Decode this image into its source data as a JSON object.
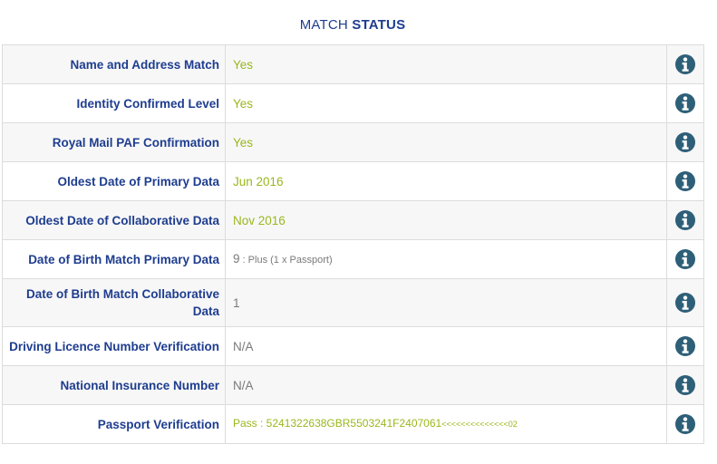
{
  "header": {
    "title_prefix": "MATCH",
    "title_strong": "STATUS"
  },
  "colors": {
    "label": "#1e3d8f",
    "value_positive": "#9ab71d",
    "value_neutral": "#7a7a7a",
    "info_icon": "#2e5f78"
  },
  "rows": [
    {
      "label": "Name and Address Match",
      "value": "Yes",
      "tone": "green",
      "icon": "info-icon"
    },
    {
      "label": "Identity Confirmed Level",
      "value": "Yes",
      "tone": "green",
      "icon": "info-icon"
    },
    {
      "label": "Royal Mail PAF Confirmation",
      "value": "Yes",
      "tone": "green",
      "icon": "info-icon"
    },
    {
      "label": "Oldest Date of Primary Data",
      "value": "Jun 2016",
      "tone": "green",
      "icon": "info-icon"
    },
    {
      "label": "Oldest Date of Collaborative Data",
      "value": "Nov 2016",
      "tone": "green",
      "icon": "info-icon"
    },
    {
      "label": "Date of Birth Match Primary Data",
      "value": "9",
      "value_detail": " : Plus (1 x Passport)",
      "tone": "grey",
      "icon": "info-icon"
    },
    {
      "label": "Date of Birth Match Collaborative Data",
      "value": "1",
      "tone": "grey",
      "icon": "info-icon"
    },
    {
      "label": "Driving Licence Number Verification",
      "value": "N/A",
      "tone": "grey",
      "icon": "info-icon"
    },
    {
      "label": "National Insurance Number",
      "value": "N/A",
      "tone": "grey",
      "icon": "info-icon"
    },
    {
      "label": "Passport Verification",
      "value": "Pass : 5241322638GBR5503241F2407061",
      "value_detail": "<<<<<<<<<<<<<<02",
      "tone": "green",
      "icon": "info-icon"
    }
  ]
}
